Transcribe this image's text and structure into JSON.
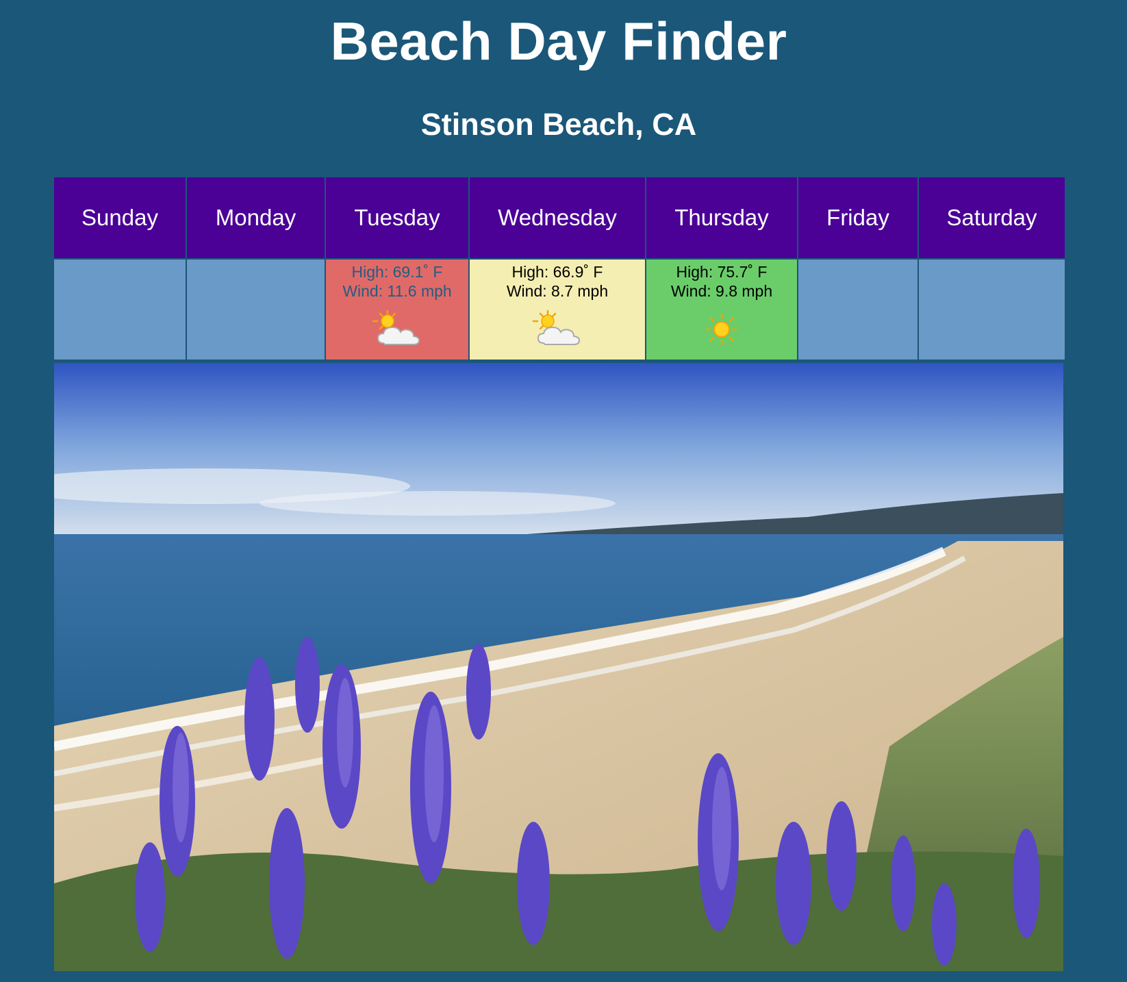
{
  "header": {
    "title": "Beach Day Finder",
    "location": "Stinson Beach, CA"
  },
  "forecast": {
    "days": [
      {
        "name": "Sunday",
        "high": "",
        "wind": "",
        "icon": "",
        "rating": "none"
      },
      {
        "name": "Monday",
        "high": "",
        "wind": "",
        "icon": "",
        "rating": "none"
      },
      {
        "name": "Tuesday",
        "high": "High: 69.1˚ F",
        "wind": "Wind: 11.6 mph",
        "icon": "partly-cloudy-icon",
        "rating": "bad"
      },
      {
        "name": "Wednesday",
        "high": "High: 66.9˚ F",
        "wind": "Wind: 8.7 mph",
        "icon": "partly-cloudy-icon",
        "rating": "ok"
      },
      {
        "name": "Thursday",
        "high": "High: 75.7˚ F",
        "wind": "Wind: 9.8 mph",
        "icon": "sun-icon",
        "rating": "good"
      },
      {
        "name": "Friday",
        "high": "",
        "wind": "",
        "icon": "",
        "rating": "none"
      },
      {
        "name": "Saturday",
        "high": "",
        "wind": "",
        "icon": "",
        "rating": "none"
      }
    ]
  },
  "colors": {
    "page_background": "#1b5779",
    "header_cell": "#4b0096",
    "empty_cell": "#6a9ac7",
    "rating_bad": "#e06a68",
    "rating_ok": "#f5eeb2",
    "rating_good": "#6acd6a"
  },
  "hero_image": {
    "subject": "coastal beach photo with purple flowers"
  }
}
